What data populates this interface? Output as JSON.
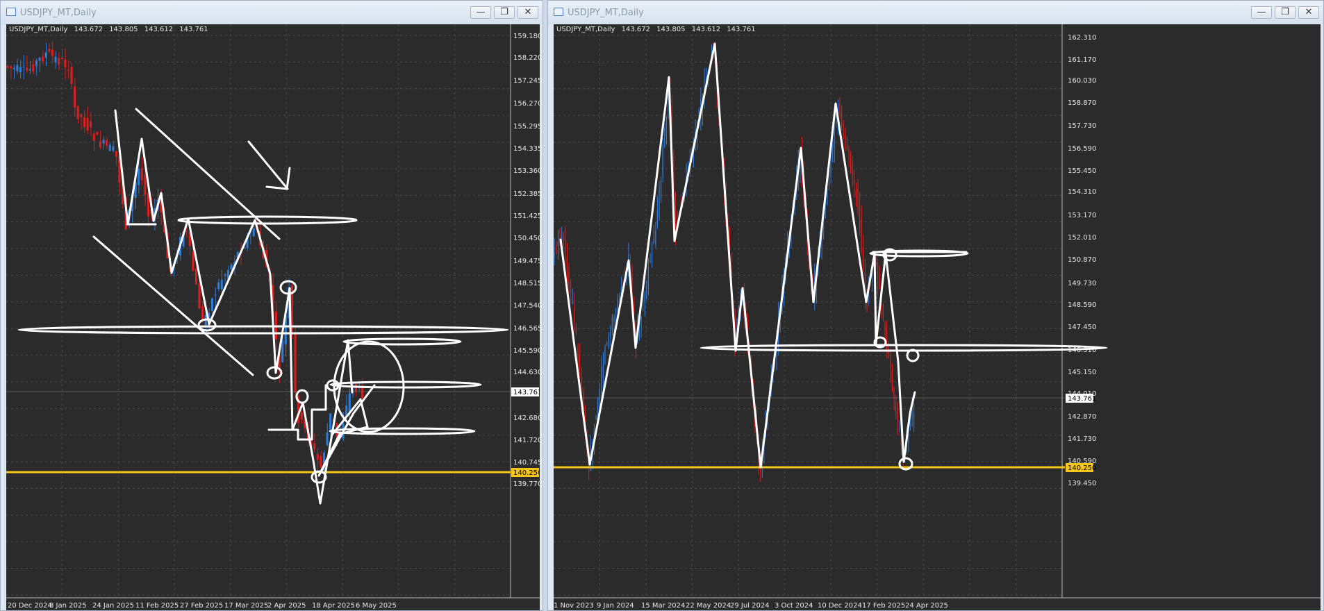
{
  "colors": {
    "bg": "#2b2b2b",
    "grid": "#4a4a4a",
    "bull": "#2f7bd8",
    "bear": "#d81e1e",
    "hline": "#f5c518",
    "ink": "#ffffff",
    "text": "#e8e8e8"
  },
  "windows": [
    {
      "title": "USDJPY_MT,Daily",
      "info": {
        "symbol": "USDJPY_MT,Daily",
        "open": "143.672",
        "high": "143.805",
        "low": "143.612",
        "close": "143.761"
      },
      "buttons": [
        "minimize",
        "restore",
        "close"
      ],
      "y_ticks": [
        "159.180",
        "158.220",
        "157.245",
        "156.270",
        "155.295",
        "154.335",
        "153.360",
        "152.385",
        "151.425",
        "150.450",
        "149.475",
        "148.515",
        "147.540",
        "146.565",
        "145.590",
        "144.630",
        "143.761",
        "142.680",
        "141.720",
        "140.745",
        "140.250",
        "139.770"
      ],
      "x_ticks": [
        "20 Dec 2024",
        "8 Jan 2025",
        "24 Jan 2025",
        "11 Feb 2025",
        "27 Feb 2025",
        "17 Mar 2025",
        "2 Apr 2025",
        "18 Apr 2025",
        "6 May 2025"
      ],
      "price_label": "143.761",
      "level_label": "140.250"
    },
    {
      "title": "USDJPY_MT,Daily",
      "info": {
        "symbol": "USDJPY_MT,Daily",
        "open": "143.672",
        "high": "143.805",
        "low": "143.612",
        "close": "143.761"
      },
      "buttons": [
        "minimize",
        "restore",
        "close"
      ],
      "y_ticks": [
        "162.310",
        "161.170",
        "160.030",
        "158.870",
        "157.730",
        "156.590",
        "155.450",
        "154.310",
        "153.170",
        "152.010",
        "150.870",
        "149.730",
        "148.590",
        "147.450",
        "146.310",
        "145.150",
        "144.010",
        "143.761",
        "142.870",
        "141.730",
        "140.590",
        "140.250",
        "139.450"
      ],
      "x_ticks": [
        "1 Nov 2023",
        "9 Jan 2024",
        "15 Mar 2024",
        "22 May 2024",
        "29 Jul 2024",
        "3 Oct 2024",
        "10 Dec 2024",
        "17 Feb 2025",
        "24 Apr 2025"
      ],
      "price_label": "143.761",
      "level_label": "140.250"
    }
  ]
}
